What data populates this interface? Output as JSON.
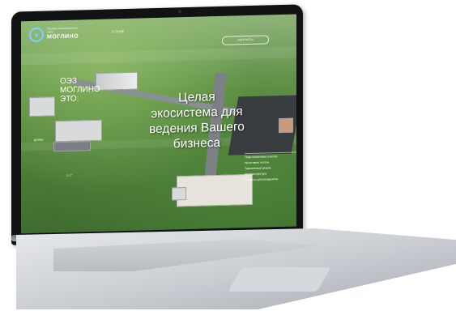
{
  "header": {
    "logo_small": "Особая экономическая зона",
    "logo_big": "МОГЛИНО",
    "nav_link": "О ЗОНЕ",
    "contacts": "КОНТАКТЫ"
  },
  "intro": {
    "line1": "ОЭЗ",
    "line2": "МОГЛИНО",
    "line3": "ЭТО:",
    "label1": "ДАЛЕЕ",
    "label2": "1 / 7"
  },
  "hero": {
    "line1": "Целая",
    "line2": "экосистема для",
    "line3": "ведения Вашего",
    "line4": "бизнеса"
  },
  "side_menu": [
    "Подготовленные участки",
    "Налоговые льготы",
    "Таможенный режим",
    "Инфраструктура",
    "Сервисы для резидентов"
  ],
  "colors": {
    "accent": "#7ad3ff",
    "grass": "#4f7f3a"
  }
}
